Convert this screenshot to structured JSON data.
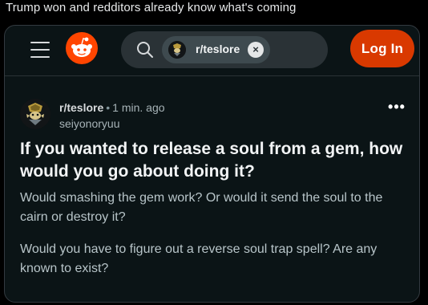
{
  "tweet": {
    "text": "Trump won and redditors already know what's coming"
  },
  "header": {
    "search_chip_label": "r/teslore",
    "chip_close_glyph": "×",
    "login_label": "Log In"
  },
  "post": {
    "subreddit": "r/teslore",
    "separator": "•",
    "time": "1 min. ago",
    "username": "seiyonoryuu",
    "more_glyph": "•••",
    "title": "If you wanted to release a soul from a gem, how would you go about doing it?",
    "paragraphs": [
      "Would smashing the gem work? Or would it send the soul to the cairn or destroy it?",
      "Would you have to figure out a reverse soul trap spell? Are any known to exist?"
    ]
  },
  "colors": {
    "brand": "#ff4500",
    "login_bg": "#d93900",
    "card_bg": "#0b1416",
    "search_bg": "#2a3236"
  },
  "icons": [
    "menu-icon",
    "reddit-logo-icon",
    "search-icon",
    "subreddit-avatar-icon",
    "close-icon",
    "more-options-icon"
  ]
}
